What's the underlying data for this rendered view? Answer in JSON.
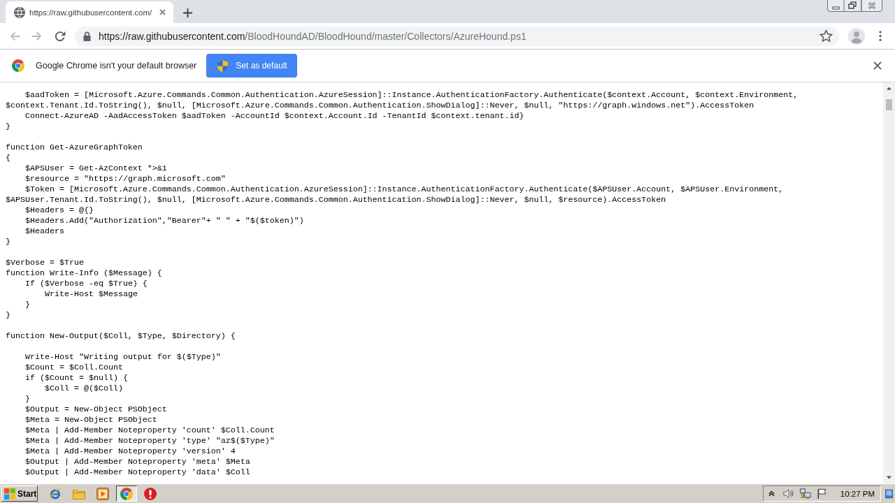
{
  "tabs": [
    {
      "title": "https://raw.githubusercontent.com/",
      "selected": true
    }
  ],
  "toolbar": {
    "back": {
      "disabled": true
    },
    "forward": {
      "disabled": true
    },
    "address": {
      "host": "https://raw.githubusercontent.com",
      "path": "/BloodHoundAD/BloodHound/master/Collectors/AzureHound.ps1"
    }
  },
  "infobar": {
    "message": "Google Chrome isn't your default browser",
    "button": "Set as default"
  },
  "document": {
    "blocks": [
      [
        "    $aadToken = [Microsoft.Azure.Commands.Common.Authentication.AzureSession]::Instance.AuthenticationFactory.Authenticate($context.Account, $context.Environment,",
        "$context.Tenant.Id.ToString(), $null, [Microsoft.Azure.Commands.Common.Authentication.ShowDialog]::Never, $null, \"https://graph.windows.net\").AccessToken",
        "    Connect-AzureAD -AadAccessToken $aadToken -AccountId $context.Account.Id -TenantId $context.tenant.id}",
        "}"
      ],
      [
        "function Get-AzureGraphToken",
        "{",
        "    $APSUser = Get-AzContext *>&1",
        "    $resource = \"https://graph.microsoft.com\"",
        "    $Token = [Microsoft.Azure.Commands.Common.Authentication.AzureSession]::Instance.AuthenticationFactory.Authenticate($APSUser.Account, $APSUser.Environment,",
        "$APSUser.Tenant.Id.ToString(), $null, [Microsoft.Azure.Commands.Common.Authentication.ShowDialog]::Never, $null, $resource).AccessToken",
        "    $Headers = @{}",
        "    $Headers.Add(\"Authorization\",\"Bearer\"+ \" \" + \"$($token)\")",
        "    $Headers",
        "}"
      ],
      [
        "$Verbose = $True",
        "function Write-Info ($Message) {",
        "    If ($Verbose -eq $True) {",
        "        Write-Host $Message",
        "    }",
        "}"
      ],
      [
        "function New-Output($Coll, $Type, $Directory) {"
      ],
      [
        "    Write-Host \"Writing output for $($Type)\"",
        "    $Count = $Coll.Count",
        "    if ($Count = $null) {",
        "        $Coll = @($Coll)",
        "    }",
        "    $Output = New-Object PSObject",
        "    $Meta = New-Object PSObject",
        "    $Meta | Add-Member Noteproperty 'count' $Coll.Count",
        "    $Meta | Add-Member Noteproperty 'type' \"az$($Type)\"",
        "    $Meta | Add-Member Noteproperty 'version' 4",
        "    $Output | Add-Member Noteproperty 'meta' $Meta",
        "    $Output | Add-Member Noteproperty 'data' $Coll"
      ]
    ]
  },
  "taskbar": {
    "start": "Start",
    "apps": [
      {
        "kind": "e-browser",
        "selected": false
      },
      {
        "kind": "folder",
        "selected": false
      },
      {
        "kind": "media",
        "selected": false
      },
      {
        "kind": "chrome",
        "selected": true
      },
      {
        "kind": "alert",
        "selected": false
      }
    ],
    "clock": "10:27 PM"
  }
}
